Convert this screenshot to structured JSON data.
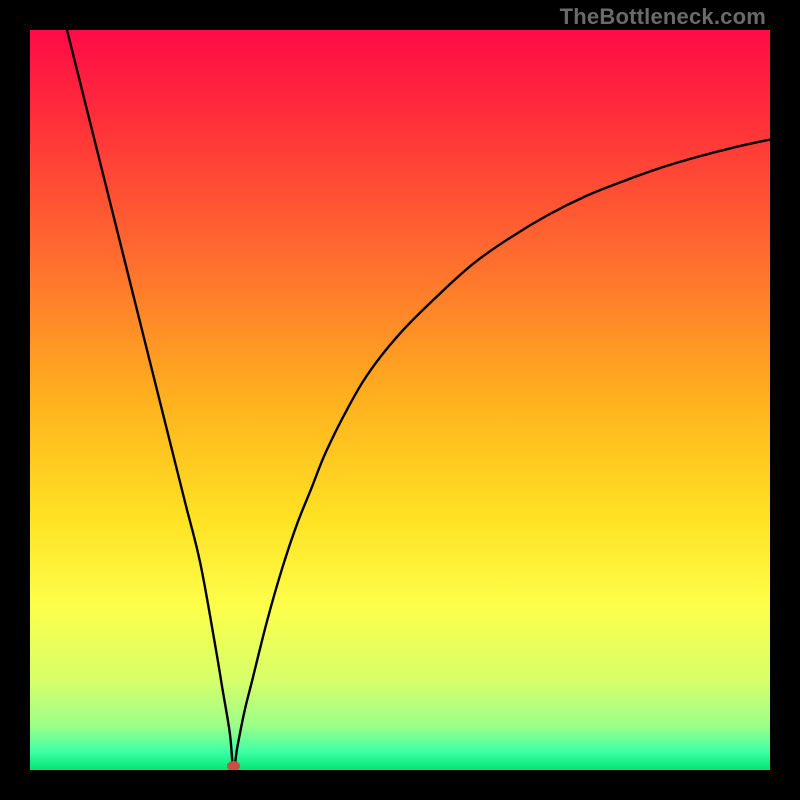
{
  "watermark": "TheBottleneck.com",
  "chart_data": {
    "type": "line",
    "title": "",
    "xlabel": "",
    "ylabel": "",
    "xlim": [
      0,
      100
    ],
    "ylim": [
      0,
      100
    ],
    "grid": false,
    "background_gradient": {
      "stops": [
        {
          "pos": 0.0,
          "color": "#ff0b47"
        },
        {
          "pos": 0.12,
          "color": "#ff2f3a"
        },
        {
          "pos": 0.3,
          "color": "#ff6a2f"
        },
        {
          "pos": 0.5,
          "color": "#ffb11e"
        },
        {
          "pos": 0.66,
          "color": "#ffe224"
        },
        {
          "pos": 0.78,
          "color": "#fdff4a"
        },
        {
          "pos": 0.88,
          "color": "#d6ff6a"
        },
        {
          "pos": 0.94,
          "color": "#9cff88"
        },
        {
          "pos": 0.975,
          "color": "#3fffa4"
        },
        {
          "pos": 1.0,
          "color": "#00e676"
        }
      ]
    },
    "min_marker": {
      "x": 27.5,
      "y": 0,
      "color": "#c94f42"
    },
    "series": [
      {
        "name": "bottleneck-curve",
        "color": "#000000",
        "x": [
          5,
          7,
          9,
          11,
          13,
          15,
          17,
          19,
          21,
          23,
          25,
          26,
          27,
          27.5,
          28,
          29,
          30,
          32,
          34,
          36,
          38,
          40,
          43,
          46,
          50,
          55,
          60,
          65,
          70,
          75,
          80,
          85,
          90,
          95,
          100
        ],
        "y": [
          100,
          92,
          84,
          76,
          68,
          60,
          52,
          44,
          36,
          28,
          17,
          11,
          5,
          0,
          3,
          8,
          12,
          20,
          27,
          33,
          38,
          43,
          49,
          54,
          59,
          64,
          68.5,
          72,
          75,
          77.5,
          79.5,
          81.3,
          82.8,
          84.1,
          85.2
        ]
      }
    ]
  }
}
